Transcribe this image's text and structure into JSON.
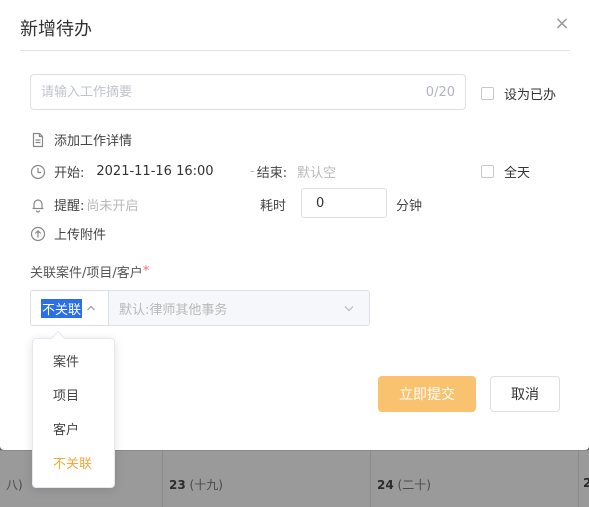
{
  "dialog": {
    "title": "新增待办",
    "close_glyph": "×"
  },
  "summary": {
    "placeholder": "请输入工作摘要",
    "counter": "0/20",
    "mark_done_label": "设为已办"
  },
  "details": {
    "add_details_label": "添加工作详情",
    "start_label": "开始:",
    "start_value": "2021-11-16 16:00",
    "end_separator": "-",
    "end_label": "结束:",
    "end_value": "默认空",
    "all_day_label": "全天",
    "reminder_label": "提醒:",
    "reminder_value": "尚未开启",
    "duration_label": "耗时",
    "duration_value": "0",
    "duration_unit": "分钟",
    "upload_label": "上传附件"
  },
  "relation": {
    "label": "关联案件/项目/客户",
    "required_mark": "*",
    "type_selected": "不关联",
    "matter_placeholder": "默认:律师其他事务"
  },
  "dropdown": {
    "options": [
      "案件",
      "项目",
      "客户",
      "不关联"
    ],
    "active_index": 3
  },
  "buttons": {
    "submit_label": "立即提交",
    "cancel_label": "取消"
  },
  "background_calendar": {
    "cells": [
      {
        "num": "",
        "lunar": "八)"
      },
      {
        "num": "23",
        "lunar": "(十九)"
      },
      {
        "num": "24",
        "lunar": "(二十)"
      },
      {
        "num": "2",
        "lunar": ""
      }
    ]
  },
  "colors": {
    "primary": "#f9c26f",
    "active_option": "#f5a83b",
    "selection_highlight": "#2a6ee8"
  },
  "icons": {
    "details": "document-icon",
    "time": "clock-icon",
    "reminder": "bell-icon",
    "upload": "upload-icon"
  }
}
